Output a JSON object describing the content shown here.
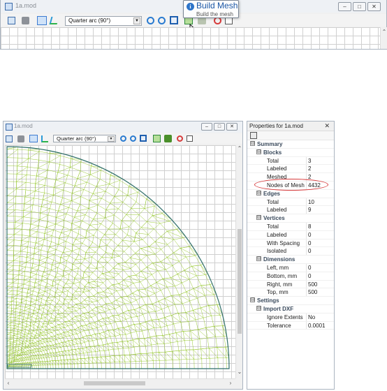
{
  "top_window": {
    "title": "1a.mod",
    "profile_select": "Quarter arc (90°)",
    "caption_buttons": [
      "–",
      "□",
      "✕"
    ]
  },
  "tooltip": {
    "title": "Build Mesh",
    "subtitle": "Build the mesh",
    "icon": "info-icon"
  },
  "bottom_window": {
    "title": "1a.mod",
    "profile_select": "Quarter arc (90°)",
    "caption_buttons": [
      "–",
      "□",
      "✕"
    ]
  },
  "properties": {
    "title": "Properties for 1a.mod",
    "close": "✕",
    "rows": [
      {
        "label": "Summary",
        "value": "",
        "level": 0,
        "category": true,
        "expander": "⊟"
      },
      {
        "label": "Blocks",
        "value": "",
        "level": 1,
        "category": true,
        "expander": "⊟"
      },
      {
        "label": "Total",
        "value": "3",
        "level": 2
      },
      {
        "label": "Labeled",
        "value": "2",
        "level": 2
      },
      {
        "label": "Meshed",
        "value": "2",
        "level": 2
      },
      {
        "label": "Nodes of Mesh",
        "value": "4432",
        "level": 2
      },
      {
        "label": "Edges",
        "value": "",
        "level": 1,
        "category": true,
        "expander": "⊟"
      },
      {
        "label": "Total",
        "value": "10",
        "level": 2
      },
      {
        "label": "Labeled",
        "value": "9",
        "level": 2
      },
      {
        "label": "Vertices",
        "value": "",
        "level": 1,
        "category": true,
        "expander": "⊟"
      },
      {
        "label": "Total",
        "value": "8",
        "level": 2
      },
      {
        "label": "Labeled",
        "value": "0",
        "level": 2
      },
      {
        "label": "With Spacing",
        "value": "0",
        "level": 2
      },
      {
        "label": "Isolated",
        "value": "0",
        "level": 2
      },
      {
        "label": "Dimensions",
        "value": "",
        "level": 1,
        "category": true,
        "expander": "⊟"
      },
      {
        "label": "Left, mm",
        "value": "0",
        "level": 2
      },
      {
        "label": "Bottom, mm",
        "value": "0",
        "level": 2
      },
      {
        "label": "Right, mm",
        "value": "500",
        "level": 2
      },
      {
        "label": "Top, mm",
        "value": "500",
        "level": 2
      },
      {
        "label": "Settings",
        "value": "",
        "level": 0,
        "category": true,
        "expander": "⊟"
      },
      {
        "label": "Import DXF",
        "value": "",
        "level": 1,
        "category": true,
        "expander": "⊟"
      },
      {
        "label": "Ignore Extents",
        "value": "No",
        "level": 2
      },
      {
        "label": "Tolerance",
        "value": "0.0001",
        "level": 2
      }
    ]
  },
  "colors": {
    "mesh": "#8fc31f",
    "arc": "#2f6e6a",
    "highlight": "#d6393a",
    "grid": "#d0d0d0"
  }
}
